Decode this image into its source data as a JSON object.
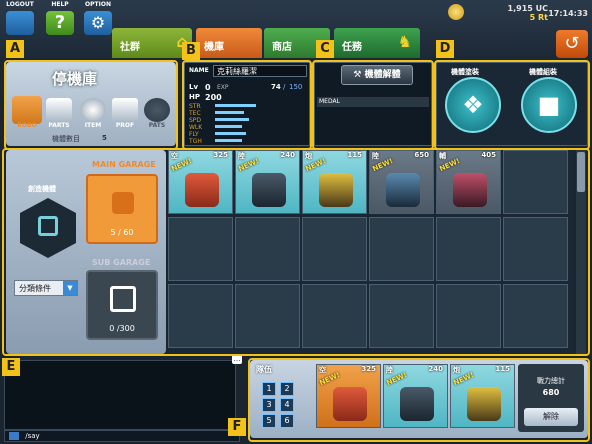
{
  "topbar": {
    "logout": "LOGOUT",
    "help": "HELP",
    "option": "OPTION",
    "tabs": [
      "社群",
      "機庫",
      "商店",
      "任務"
    ],
    "uc": "1,915 UC",
    "rt": "5 Rt",
    "clock": "17:14:33",
    "colors": {
      "social": "#7fa22a",
      "hangar": "#e0732a",
      "shop": "#3e9a3e",
      "mission": "#2e8a3e"
    }
  },
  "annot": {
    "a": "A",
    "b": "B",
    "c": "C",
    "d": "D",
    "e": "E",
    "f": "F"
  },
  "hangar": {
    "title": "停機庫",
    "icons": [
      "ROBO",
      "PARTS",
      "ITEM",
      "PROF",
      "PATS"
    ],
    "count_label": "機體數目",
    "count": "5"
  },
  "info": {
    "name_label": "NAME",
    "name": "克莉絲羅潔",
    "lv_label": "Lv",
    "lv": "0",
    "exp_label": "EXP",
    "exp": "74",
    "exp_max": "150",
    "hp_label": "HP",
    "hp": "200",
    "stats": [
      "STR",
      "TEC",
      "SPD",
      "WLK",
      "FLY",
      "TGH"
    ],
    "stat_levels": [
      0.45,
      0.32,
      0.38,
      0.3,
      0.34,
      0.3
    ]
  },
  "breakdown": {
    "button": "機體解體",
    "medal": "MEDAL"
  },
  "paint": {
    "paint_label": "機體塗裝",
    "assemble_label": "機體組裝"
  },
  "garage": {
    "create_label": "創造機體",
    "main_label": "MAIN GARAGE",
    "main_count": "5 / 60",
    "sub_label": "SUB GARAGE",
    "sub_count": "0 /300",
    "filter": "分類條件",
    "units": [
      {
        "name": "空",
        "num": "325"
      },
      {
        "name": "陸",
        "num": "240"
      },
      {
        "name": "炮",
        "num": "115"
      },
      {
        "name": "陸",
        "num": "650"
      },
      {
        "name": "輔",
        "num": "405"
      }
    ],
    "new_tag": "NEW!"
  },
  "chat": {
    "say": "/say"
  },
  "team": {
    "label": "隊伍",
    "nums": [
      "1",
      "2",
      "3",
      "4",
      "5",
      "6"
    ],
    "power_label": "戰力總計",
    "power": "680",
    "dismiss": "解除",
    "units": [
      {
        "name": "空",
        "num": "325"
      },
      {
        "name": "陸",
        "num": "240"
      },
      {
        "name": "炮",
        "num": "115"
      }
    ]
  }
}
